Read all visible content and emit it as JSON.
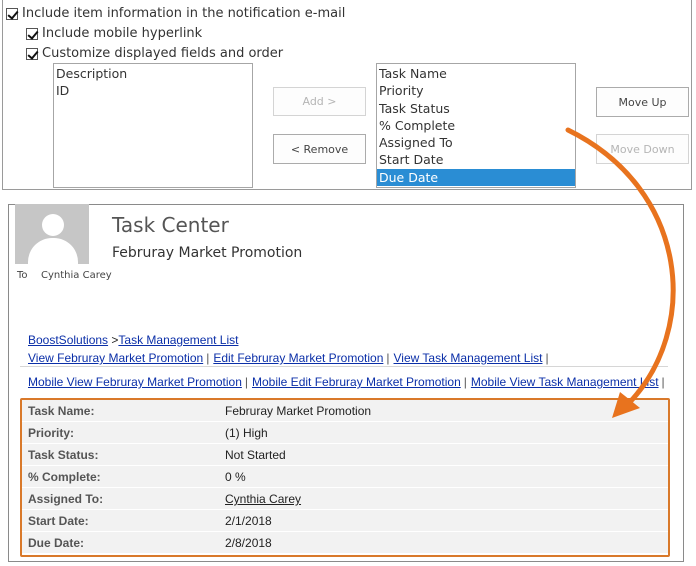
{
  "settings": {
    "include_item_info": "Include item information in the notification e-mail",
    "include_mobile_link": "Include mobile hyperlink",
    "customize_fields": "Customize displayed fields and order",
    "available_fields": [
      "Description",
      "ID"
    ],
    "selected_fields": [
      "Task Name",
      "Priority",
      "Task Status",
      "% Complete",
      "Assigned To",
      "Start Date",
      "Due Date"
    ],
    "selected_field_highlighted": "Due Date",
    "buttons": {
      "add": "Add >",
      "remove": "< Remove",
      "move_up": "Move Up",
      "move_down": "Move Down"
    }
  },
  "email": {
    "sender": "Task Center",
    "subject": "Februray Market Promotion",
    "to_label": "To",
    "to_name": "Cynthia Carey",
    "breadcrumb": {
      "site": "BoostSolutions",
      "separator": " >",
      "list": "Task Management List"
    },
    "links": [
      "View Februray Market Promotion",
      "Edit Februray Market Promotion",
      "View Task Management List"
    ],
    "mobile_links": [
      "Mobile View Februray Market Promotion",
      "Mobile Edit Februray Market Promotion",
      "Mobile View Task Management List"
    ],
    "separator": "|",
    "details": [
      {
        "label": "Task Name:",
        "value": "Februray Market Promotion"
      },
      {
        "label": "Priority:",
        "value": "(1) High"
      },
      {
        "label": "Task Status:",
        "value": "Not Started"
      },
      {
        "label": "% Complete:",
        "value": "0 %"
      },
      {
        "label": "Assigned To:",
        "value": "Cynthia Carey"
      },
      {
        "label": "Start Date:",
        "value": "2/1/2018"
      },
      {
        "label": "Due Date:",
        "value": "2/8/2018"
      }
    ]
  },
  "colors": {
    "highlight": "#d9792a",
    "selected_option": "#2a8dd4",
    "link": "#0b2fa8"
  }
}
